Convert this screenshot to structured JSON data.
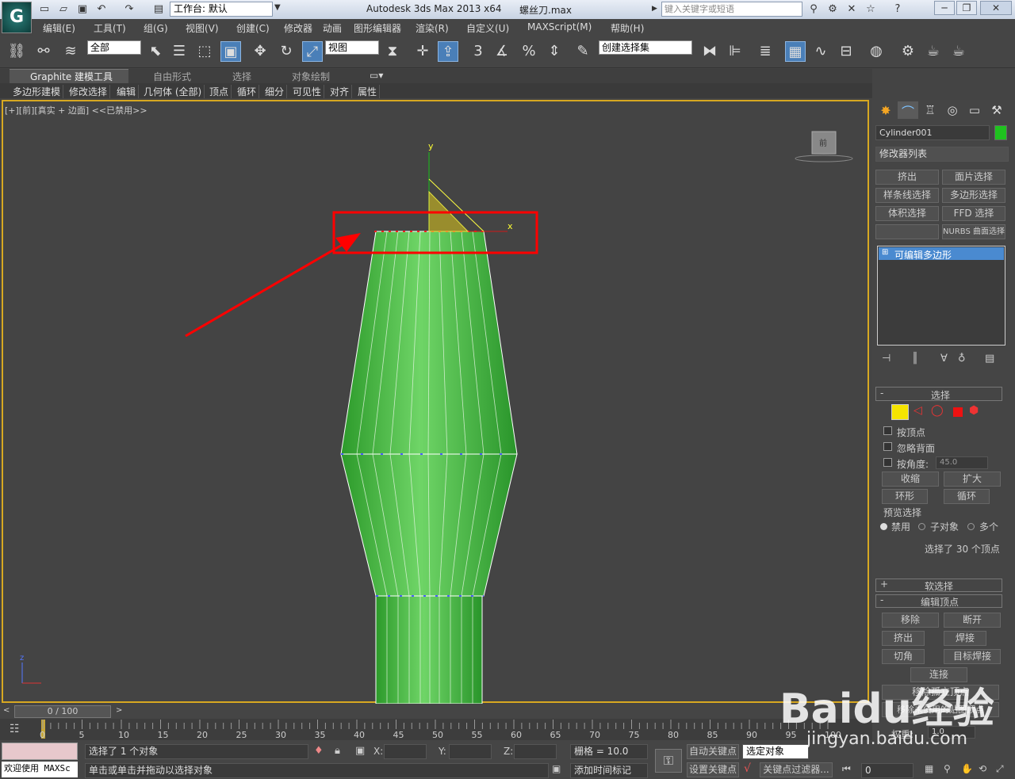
{
  "title": {
    "workspace_label": "工作台: 默认",
    "app_title": "Autodesk 3ds Max  2013 x64",
    "file_name": "螺丝刀.max",
    "search_placeholder": "键入关键字或短语"
  },
  "menu": [
    "编辑(E)",
    "工具(T)",
    "组(G)",
    "视图(V)",
    "创建(C)",
    "修改器",
    "动画",
    "图形编辑器",
    "渲染(R)",
    "自定义(U)",
    "MAXScript(M)",
    "帮助(H)"
  ],
  "toolbar": {
    "selection_filter": "全部",
    "ref_coord": "视图",
    "named_selection": "创建选择集"
  },
  "ribbon_tabs": [
    "Graphite 建模工具",
    "自由形式",
    "选择",
    "对象绘制"
  ],
  "ribbon_panels": [
    "多边形建模",
    "修改选择",
    "编辑",
    "几何体 (全部)",
    "顶点",
    "循环",
    "细分",
    "可见性",
    "对齐",
    "属性"
  ],
  "viewport": {
    "label": "[+][前][真实 + 边面] <<已禁用>>",
    "gizmo_y": "y",
    "gizmo_x": "x",
    "axis_z": "z",
    "viewcube": "前",
    "highlight_color": "#ff0000",
    "mesh_color": "#3cbc35"
  },
  "command_panel": {
    "object_name": "Cylinder001",
    "object_color": "#1fc31f",
    "modifier_list": "修改器列表",
    "modifier_buttons": [
      "挤出",
      "面片选择",
      "样条线选择",
      "多边形选择",
      "体积选择",
      "FFD 选择",
      "",
      "NURBS 曲面选择"
    ],
    "stack_item": "可编辑多边形",
    "selection_header": "选择",
    "by_vertex": "按顶点",
    "ignore_backface": "忽略背面",
    "by_angle": "按角度:",
    "angle_value": "45.0",
    "shrink": "收缩",
    "grow": "扩大",
    "ring": "环形",
    "loop": "循环",
    "preview_selection": "预览选择",
    "preview_options": [
      "禁用",
      "子对象",
      "多个"
    ],
    "selected_info": "选择了 30 个顶点",
    "soft_selection": "软选择",
    "edit_vertices": "编辑顶点",
    "remove": "移除",
    "break": "断开",
    "extrude": "挤出",
    "weld": "焊接",
    "chamfer": "切角",
    "target_weld": "目标焊接",
    "connect": "连接",
    "remove_isolated": "移除孤立顶点",
    "remove_unused_map": "移除未使用的贴图顶点",
    "weight_label": "权重:",
    "weight_value": "1.0"
  },
  "timeline": {
    "frame": "0 / 100",
    "ticks": [
      "0",
      "5",
      "10",
      "15",
      "20",
      "25",
      "30",
      "35",
      "40",
      "45",
      "50",
      "55",
      "60",
      "65",
      "70",
      "75",
      "80",
      "85",
      "90",
      "95",
      "100"
    ]
  },
  "status": {
    "welcome": "欢迎使用 MAXSc",
    "selected": "选择了 1 个对象",
    "prompt": "单击或单击并拖动以选择对象",
    "x_label": "X:",
    "y_label": "Y:",
    "z_label": "Z:",
    "grid": "栅格 = 10.0",
    "add_time_tag": "添加时间标记",
    "auto_key": "自动关键点",
    "selected_objects": "选定对象",
    "set_key": "设置关键点",
    "key_filters": "关键点过滤器...",
    "frame_value": "0"
  },
  "watermark": {
    "brand": "Baidu经验",
    "url": "jingyan.baidu.com"
  }
}
